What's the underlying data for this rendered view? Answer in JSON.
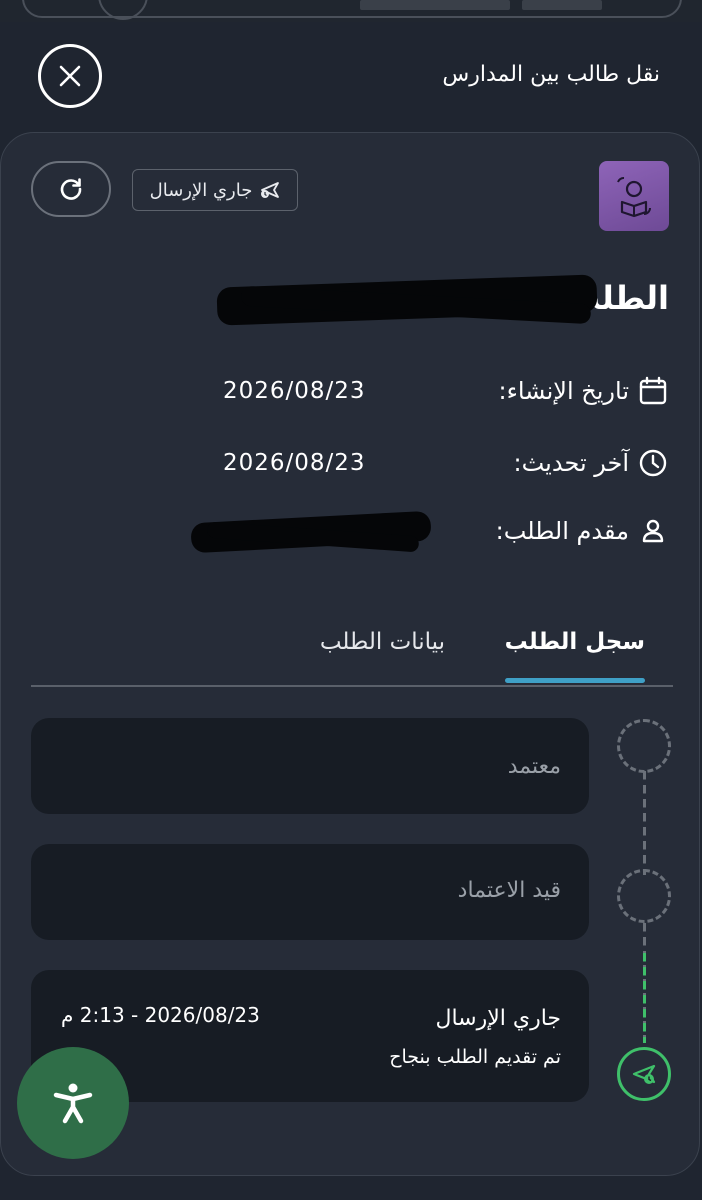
{
  "header": {
    "title": "نقل طالب بين المدارس"
  },
  "card": {
    "status_chip": "جاري الإرسال",
    "request_title": "الطلب",
    "info": [
      {
        "label": "تاريخ الإنشاء:",
        "value": "2026/08/23",
        "icon": "calendar-icon"
      },
      {
        "label": "آخر تحديث:",
        "value": "2026/08/23",
        "icon": "clock-icon"
      },
      {
        "label": "مقدم الطلب:",
        "value": "",
        "icon": "person-icon"
      }
    ],
    "tabs": [
      {
        "label": "سجل الطلب",
        "active": true
      },
      {
        "label": "بيانات الطلب",
        "active": false
      }
    ],
    "timeline": [
      {
        "label": "معتمد",
        "state": "pending"
      },
      {
        "label": "قيد الاعتماد",
        "state": "pending"
      },
      {
        "label": "جاري الإرسال",
        "state": "done",
        "datetime": "2026/08/23 - 2:13 م",
        "note": "تم تقديم الطلب بنجاح"
      }
    ]
  },
  "colors": {
    "background": "#1f2530",
    "card": "#262c38",
    "accent_tab": "#3fa0c6",
    "done_green": "#3fc06a",
    "a11y_button": "#2f6e48",
    "service_icon": "#7e56a6"
  },
  "icons": {
    "close": "close-icon",
    "refresh": "refresh-icon",
    "send": "send-icon",
    "service": "student-book-icon",
    "accessibility": "accessibility-icon"
  }
}
